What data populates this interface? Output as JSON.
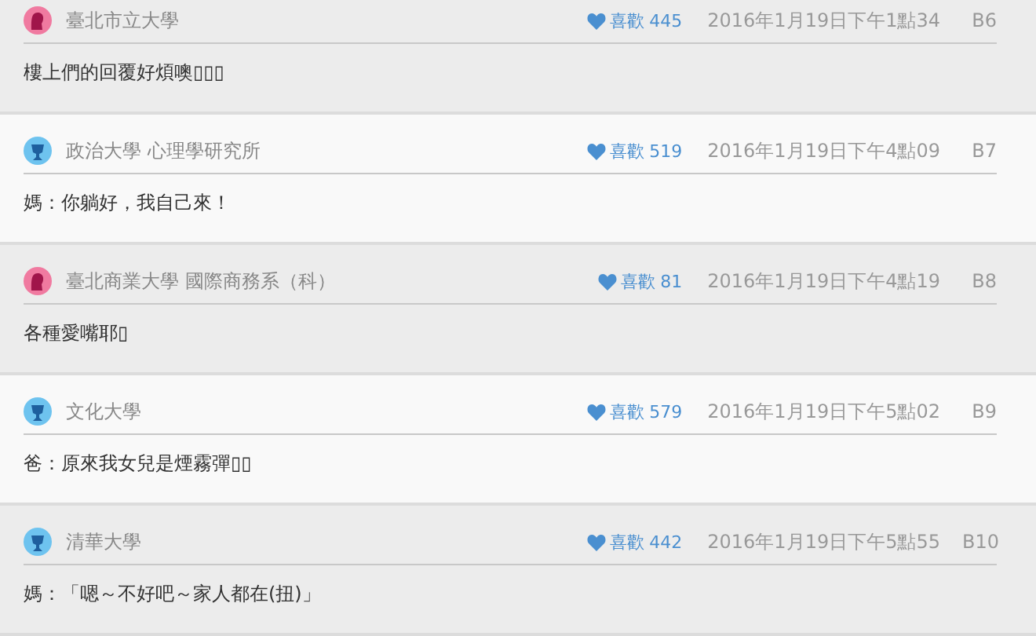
{
  "comments": [
    {
      "kind": "female",
      "school": "臺北市立大學",
      "likes_label": "喜歡",
      "likes": "445",
      "time": "2016年1月19日下午1點34",
      "floor": "B6",
      "text": "樓上們的回覆好煩噢▯▯▯"
    },
    {
      "kind": "male",
      "school": "政治大學 心理學研究所",
      "likes_label": "喜歡",
      "likes": "519",
      "time": "2016年1月19日下午4點09",
      "floor": "B7",
      "text": "媽：你躺好，我自己來！"
    },
    {
      "kind": "female",
      "school": "臺北商業大學 國際商務系（科）",
      "likes_label": "喜歡",
      "likes": "81",
      "time": "2016年1月19日下午4點19",
      "floor": "B8",
      "text": "各種愛嘴耶▯"
    },
    {
      "kind": "male",
      "school": "文化大學",
      "likes_label": "喜歡",
      "likes": "579",
      "time": "2016年1月19日下午5點02",
      "floor": "B9",
      "text": "爸：原來我女兒是煙霧彈▯▯"
    },
    {
      "kind": "male",
      "school": "清華大學",
      "likes_label": "喜歡",
      "likes": "442",
      "time": "2016年1月19日下午5點55",
      "floor": "B10",
      "text": "媽：「嗯～不好吧～家人都在(扭)」"
    }
  ]
}
